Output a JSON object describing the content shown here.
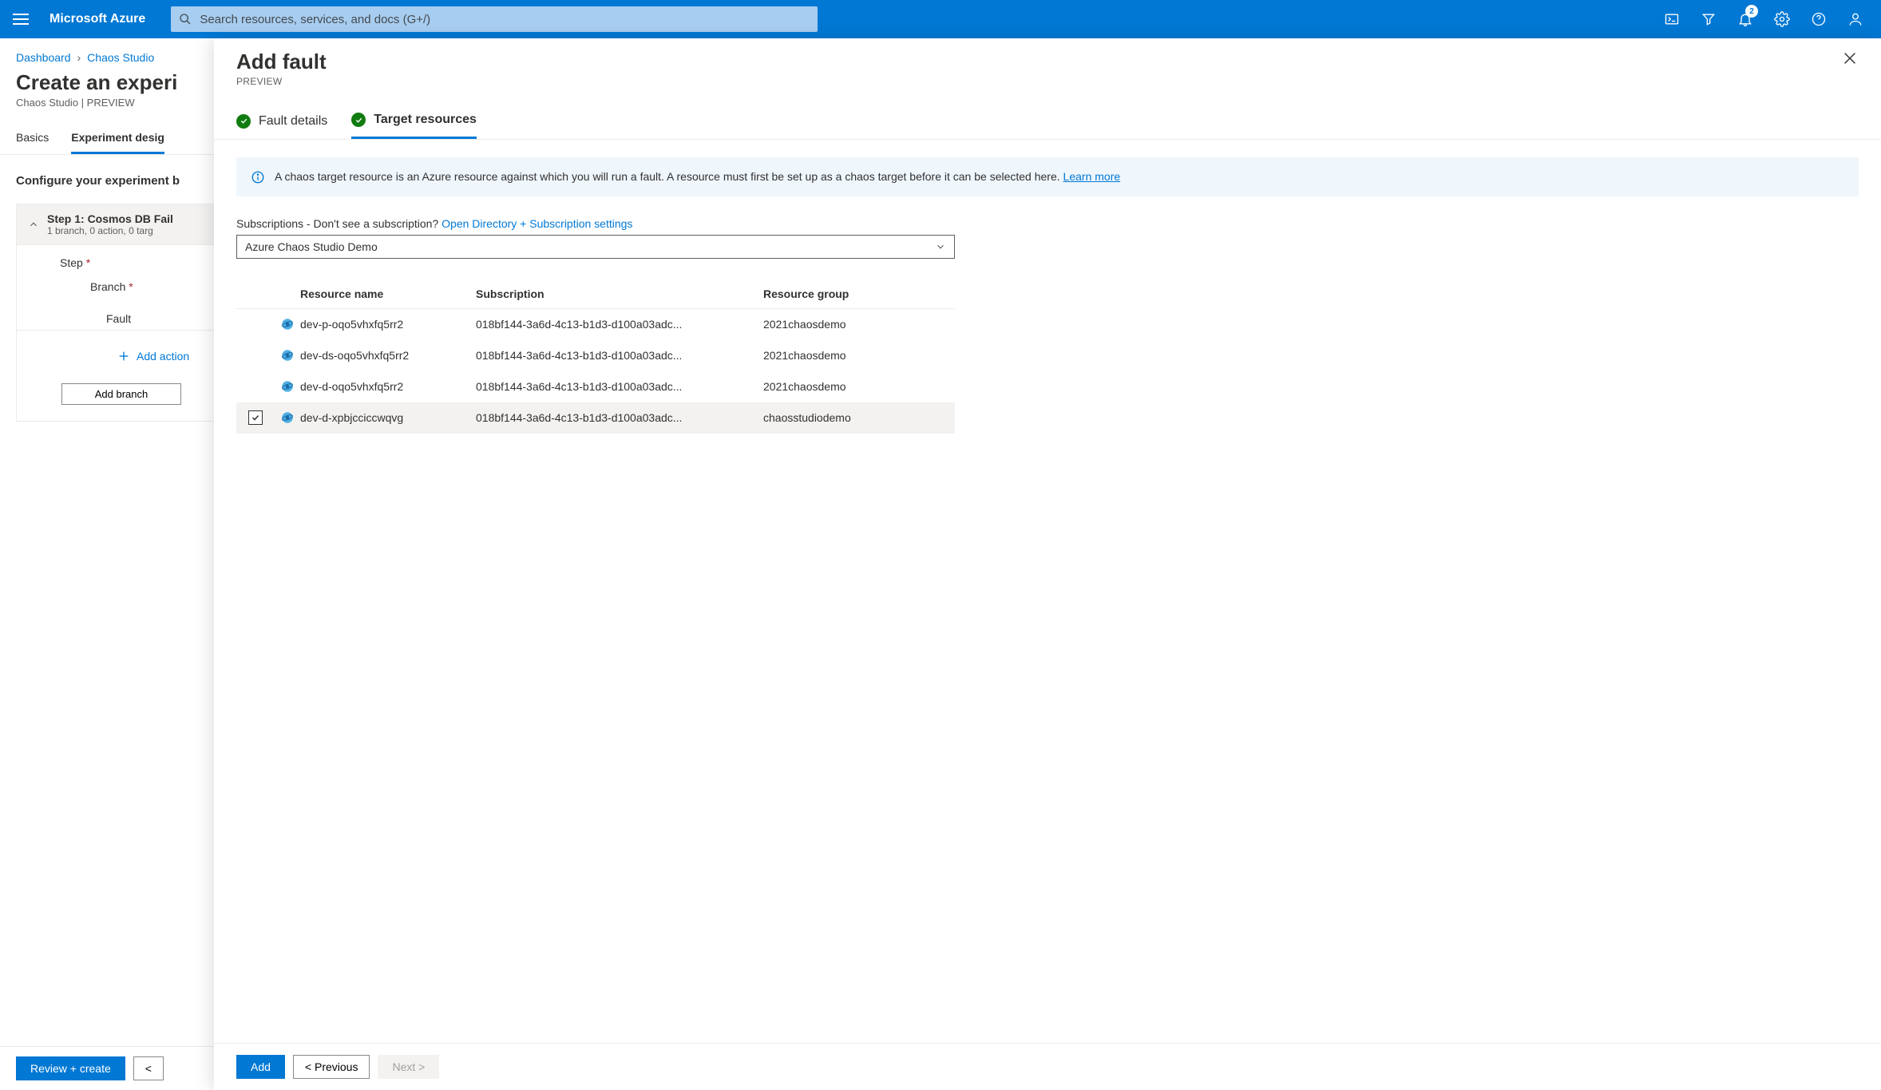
{
  "header": {
    "brand": "Microsoft Azure",
    "search_placeholder": "Search resources, services, and docs (G+/)",
    "notification_count": "2"
  },
  "breadcrumbs": {
    "dashboard": "Dashboard",
    "chaos": "Chaos Studio"
  },
  "underpage": {
    "title": "Create an experi",
    "subtitle": "Chaos Studio | PREVIEW",
    "tabs": {
      "basics": "Basics",
      "design": "Experiment desig"
    },
    "config_heading": "Configure your experiment b",
    "step_title": "Step 1: Cosmos DB Fail",
    "step_sub": "1 branch, 0 action, 0 targ",
    "step_label": "Step",
    "branch_label": "Branch",
    "fault_label": "Fault",
    "add_action": "Add action",
    "add_branch": "Add branch",
    "review_create": "Review + create",
    "prev_short": "<"
  },
  "panel": {
    "title": "Add fault",
    "preview": "PREVIEW",
    "tabs": {
      "fault": "Fault details",
      "target": "Target resources"
    },
    "info_text_a": "A chaos target resource is an Azure resource against which you will run a fault. A resource must first be set up as a chaos target before it can be selected here. ",
    "info_link": "Learn more",
    "subs_label_a": "Subscriptions - Don't see a subscription? ",
    "subs_link": "Open Directory + Subscription settings",
    "dropdown_value": "Azure Chaos Studio Demo",
    "columns": {
      "name": "Resource name",
      "sub": "Subscription",
      "rg": "Resource group"
    },
    "rows": [
      {
        "name": "dev-p-oqo5vhxfq5rr2",
        "sub": "018bf144-3a6d-4c13-b1d3-d100a03adc...",
        "rg": "2021chaosdemo",
        "selected": false
      },
      {
        "name": "dev-ds-oqo5vhxfq5rr2",
        "sub": "018bf144-3a6d-4c13-b1d3-d100a03adc...",
        "rg": "2021chaosdemo",
        "selected": false
      },
      {
        "name": "dev-d-oqo5vhxfq5rr2",
        "sub": "018bf144-3a6d-4c13-b1d3-d100a03adc...",
        "rg": "2021chaosdemo",
        "selected": false
      },
      {
        "name": "dev-d-xpbjcciccwqvg",
        "sub": "018bf144-3a6d-4c13-b1d3-d100a03adc...",
        "rg": "chaosstudiodemo",
        "selected": true
      }
    ],
    "footer": {
      "add": "Add",
      "prev": "< Previous",
      "next": "Next >"
    }
  }
}
